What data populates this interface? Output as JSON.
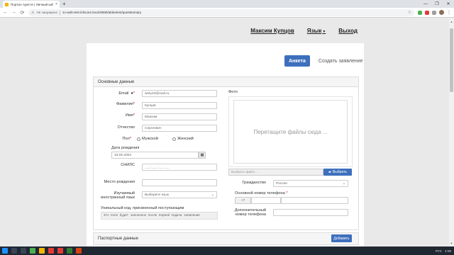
{
  "browser": {
    "tab_title": "Портал Аресте | Личный кабин...",
    "tab_close": "×",
    "new_tab": "+",
    "window_controls": [
      "—",
      "❐",
      "✕"
    ],
    "security_text": "Не защищено",
    "url": "1c-web-test.infocom.local:8080/abiturient/questionnary"
  },
  "topnav": {
    "user_name": "Максим Купцов",
    "language": "Язык",
    "logout": "Выход"
  },
  "tabs": {
    "active": "Анкета",
    "inactive": "Создать заявление"
  },
  "basic_section": {
    "title": "Основные данные",
    "email_label": "Email",
    "email_value": "wety23@mail.ru",
    "last_name_label": "Фамилия",
    "last_name_value": "Купцов",
    "first_name_label": "Имя",
    "first_name_value": "Максим",
    "patronymic_label": "Отчество",
    "patronymic_value": "Сергеевич",
    "sex_label": "Пол",
    "sex_male": "Мужской",
    "sex_female": "Женский",
    "birth_date_label": "Дата рождения",
    "birth_date_value": "16.05.2003",
    "snils_label": "СНИЛС",
    "snils_value": "___-___-___ __",
    "birthplace_label": "Место рождения",
    "birthplace_value": "",
    "foreign_lang_label_1": "Изучаемый",
    "foreign_lang_label_2": "иностранный язык",
    "foreign_lang_value": "Выберите язык",
    "unique_code_label": "Уникальный код, присвоенный поступающим",
    "unique_code_value": "Это поле будет заполнено после первой подачи заявления",
    "photo_label": "Фото",
    "photo_drop_text": "Перетащите файлы сюда ...",
    "file_placeholder": "Выбрать файл...",
    "file_button": "Выбрать",
    "citizenship_label": "Гражданство",
    "citizenship_value": "Россия",
    "main_phone_label": "Основной номер телефона",
    "phone_prefix": "+7",
    "extra_phone_label_1": "Дополнительный",
    "extra_phone_label_2": "номер телефона"
  },
  "passport_section": {
    "title": "Паспортные данные",
    "add_button": "Добавить"
  },
  "taskbar": {
    "lang": "РУС",
    "time": "4:08"
  }
}
